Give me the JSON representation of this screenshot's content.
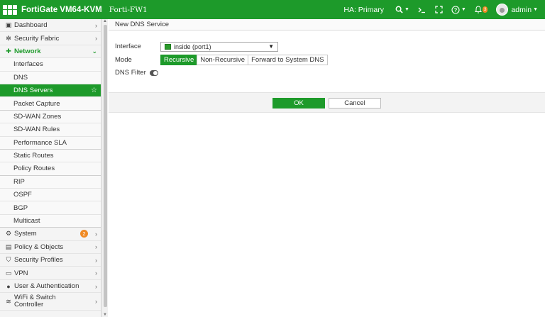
{
  "header": {
    "brand": "FortiGate VM64-KVM",
    "hostname": "Forti-FW1",
    "ha_status": "HA: Primary",
    "notification_count": "3",
    "user": "admin",
    "icons": [
      "search-icon",
      "cli-icon",
      "fullscreen-icon",
      "help-icon",
      "bell-icon",
      "avatar"
    ]
  },
  "sidebar": {
    "items": [
      {
        "label": "Dashboard",
        "icon": "dashboard-icon"
      },
      {
        "label": "Security Fabric",
        "icon": "fabric-icon"
      },
      {
        "label": "Network",
        "icon": "network-icon"
      },
      {
        "label": "Interfaces"
      },
      {
        "label": "DNS"
      },
      {
        "label": "DNS Servers"
      },
      {
        "label": "Packet Capture"
      },
      {
        "label": "SD-WAN Zones"
      },
      {
        "label": "SD-WAN Rules"
      },
      {
        "label": "Performance SLA"
      },
      {
        "label": "Static Routes"
      },
      {
        "label": "Policy Routes"
      },
      {
        "label": "RIP"
      },
      {
        "label": "OSPF"
      },
      {
        "label": "BGP"
      },
      {
        "label": "Multicast"
      },
      {
        "label": "System",
        "icon": "gear-icon",
        "badge": "2"
      },
      {
        "label": "Policy & Objects",
        "icon": "policy-icon"
      },
      {
        "label": "Security Profiles",
        "icon": "shield-icon"
      },
      {
        "label": "VPN",
        "icon": "vpn-icon"
      },
      {
        "label": "User & Authentication",
        "icon": "user-icon"
      },
      {
        "label": "WiFi & Switch Controller",
        "line1": "WiFi & Switch",
        "line2": "Controller",
        "icon": "wifi-icon"
      }
    ]
  },
  "main": {
    "panel_title": "New DNS Service",
    "form": {
      "interface_label": "Interface",
      "interface_value": "inside (port1)",
      "mode_label": "Mode",
      "mode_options": [
        "Recursive",
        "Non-Recursive",
        "Forward to System DNS"
      ],
      "mode_selected": "Recursive",
      "dns_filter_label": "DNS Filter",
      "dns_filter_enabled": false
    },
    "buttons": {
      "ok": "OK",
      "cancel": "Cancel"
    }
  },
  "colors": {
    "brand_green": "#1d9a2a",
    "badge_orange": "#f08a24"
  }
}
